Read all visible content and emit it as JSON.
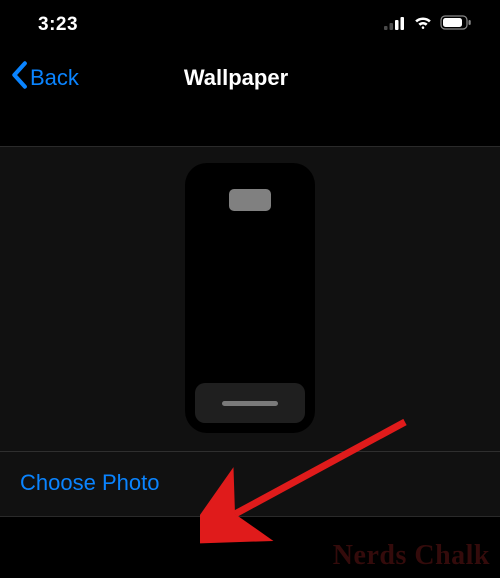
{
  "status": {
    "time": "3:23"
  },
  "nav": {
    "back_label": "Back",
    "title": "Wallpaper"
  },
  "actions": {
    "choose_photo": "Choose Photo"
  },
  "watermark": "Nerds Chalk",
  "colors": {
    "accent": "#0a84ff"
  }
}
